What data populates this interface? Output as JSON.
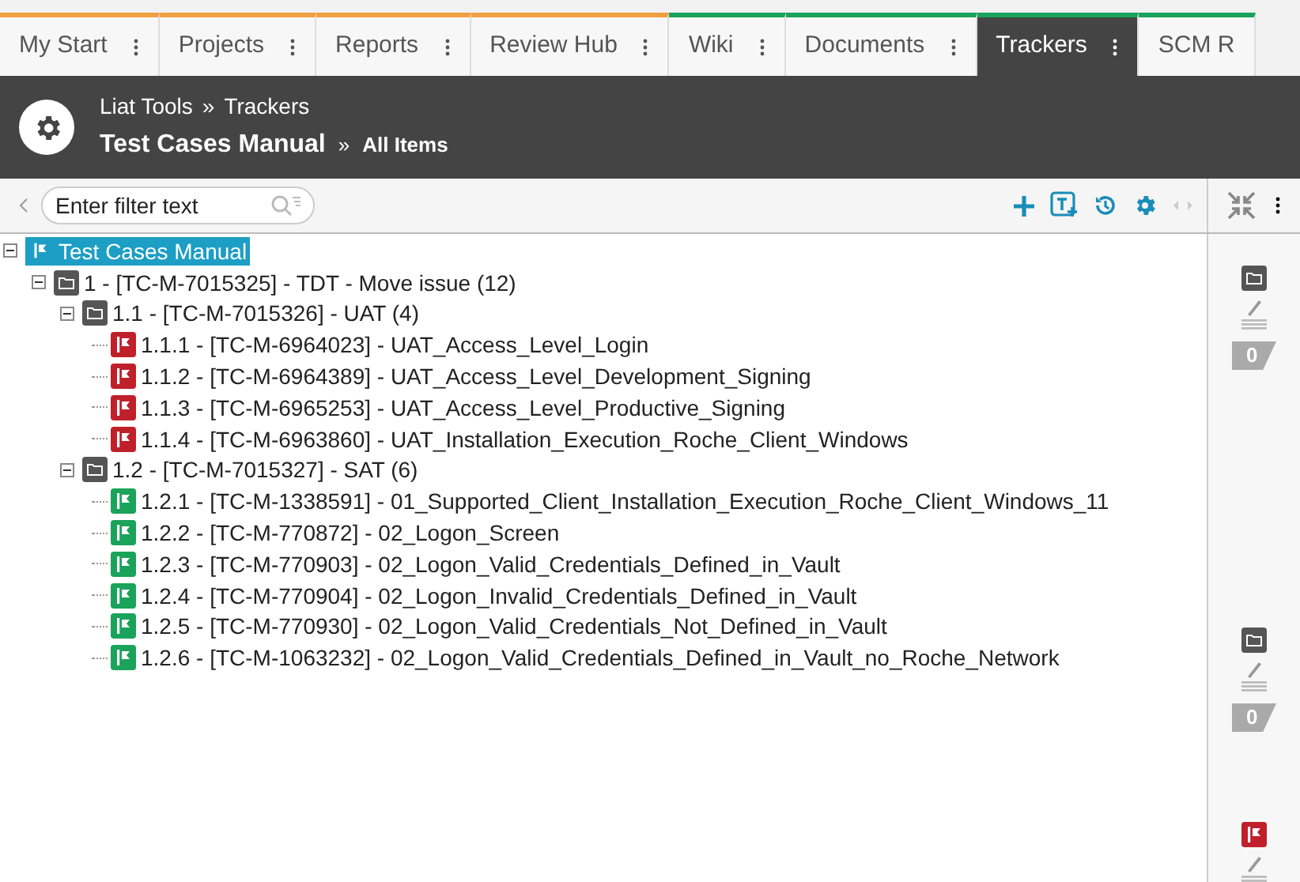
{
  "tabs": [
    {
      "label": "My Start",
      "selected": false,
      "color": "#f0a040"
    },
    {
      "label": "Projects",
      "selected": false,
      "color": "#f0a040"
    },
    {
      "label": "Reports",
      "selected": false,
      "color": "#f0a040"
    },
    {
      "label": "Review Hub",
      "selected": false,
      "color": "#f0a040"
    },
    {
      "label": "Wiki",
      "selected": false,
      "color": "#1aa35a"
    },
    {
      "label": "Documents",
      "selected": false,
      "color": "#1aa35a"
    },
    {
      "label": "Trackers",
      "selected": true,
      "color": "#1aa35a"
    },
    {
      "label": "SCM R",
      "selected": false,
      "color": "#1aa35a"
    }
  ],
  "header": {
    "breadcrumb": [
      "Liat Tools",
      "Trackers"
    ],
    "separator": "»",
    "title": "Test Cases Manual",
    "view": "All Items"
  },
  "toolbar": {
    "filter": {
      "placeholder": "Enter filter text"
    }
  },
  "tree": [
    {
      "kind": "root",
      "label": "Test Cases Manual",
      "selected": true,
      "expanded": true,
      "children": [
        {
          "kind": "folder",
          "label": "1 - [TC-M-7015325] - TDT - Move issue (12)",
          "selected": false,
          "expanded": true,
          "children": [
            {
              "kind": "folder",
              "label": "1.1 - [TC-M-7015326] - UAT (4)",
              "selected": false,
              "expanded": true,
              "children": [
                {
                  "kind": "item",
                  "color": "#c0202a",
                  "label": "1.1.1 - [TC-M-6964023] - UAT_Access_Level_Login",
                  "selected": false
                },
                {
                  "kind": "item",
                  "color": "#c0202a",
                  "label": "1.1.2 - [TC-M-6964389] - UAT_Access_Level_Development_Signing",
                  "selected": false
                },
                {
                  "kind": "item",
                  "color": "#c0202a",
                  "label": "1.1.3 - [TC-M-6965253] - UAT_Access_Level_Productive_Signing",
                  "selected": false
                },
                {
                  "kind": "item",
                  "color": "#c0202a",
                  "label": "1.1.4 - [TC-M-6963860] - UAT_Installation_Execution_Roche_Client_Windows",
                  "selected": false
                }
              ]
            },
            {
              "kind": "folder",
              "label": "1.2 - [TC-M-7015327] - SAT (6)",
              "selected": false,
              "expanded": true,
              "children": [
                {
                  "kind": "item",
                  "color": "#1aa35a",
                  "label": "1.2.1 - [TC-M-1338591] - 01_Supported_Client_Installation_Execution_Roche_Client_Windows_11",
                  "selected": false
                },
                {
                  "kind": "item",
                  "color": "#1aa35a",
                  "label": "1.2.2 - [TC-M-770872] - 02_Logon_Screen",
                  "selected": false
                },
                {
                  "kind": "item",
                  "color": "#1aa35a",
                  "label": "1.2.3 - [TC-M-770903] - 02_Logon_Valid_Credentials_Defined_in_Vault",
                  "selected": false
                },
                {
                  "kind": "item",
                  "color": "#1aa35a",
                  "label": "1.2.4 - [TC-M-770904] - 02_Logon_Invalid_Credentials_Defined_in_Vault",
                  "selected": false
                },
                {
                  "kind": "item",
                  "color": "#1aa35a",
                  "label": "1.2.5 - [TC-M-770930] - 02_Logon_Valid_Credentials_Not_Defined_in_Vault",
                  "selected": false
                },
                {
                  "kind": "item",
                  "color": "#1aa35a",
                  "label": "1.2.6 - [TC-M-1063232] - 02_Logon_Valid_Credentials_Defined_in_Vault_no_Roche_Network",
                  "selected": false
                }
              ]
            }
          ]
        }
      ]
    }
  ],
  "side_panel": [
    {
      "kind": "folder",
      "count": "0"
    },
    {
      "kind": "folder",
      "count": "0"
    },
    {
      "kind": "item",
      "color": "#c0202a"
    }
  ]
}
